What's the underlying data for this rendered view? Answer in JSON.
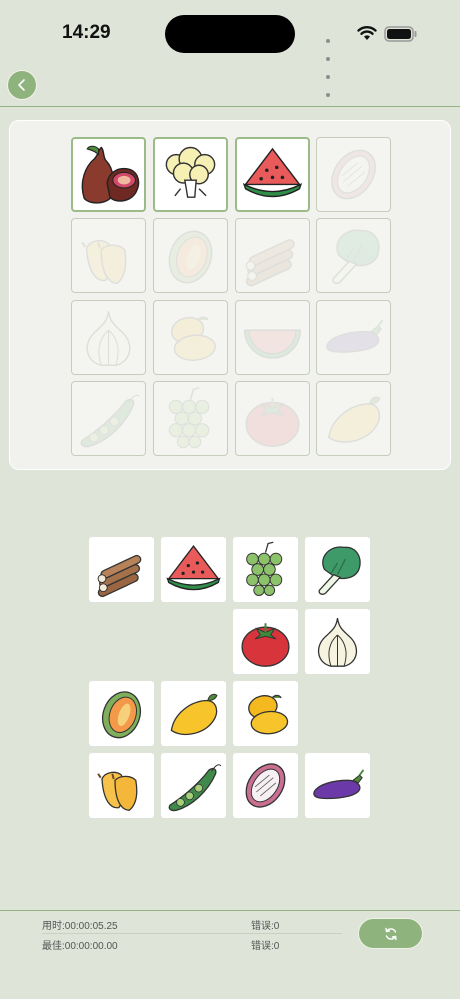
{
  "status_bar": {
    "time": "14:29"
  },
  "icons": {
    "back": "chevron-left-icon",
    "reset": "refresh-icon",
    "wifi": "wifi-icon",
    "battery": "battery-icon"
  },
  "colors": {
    "background": "#dfe4d8",
    "accent": "#8fb37d",
    "board": "#f1f2ed"
  },
  "target_board": {
    "rows": [
      [
        "fig",
        "cauliflower",
        "watermelon",
        "dragon-fruit"
      ],
      [
        "banana",
        "cantaloupe",
        "yam",
        "bok-choy"
      ],
      [
        "garlic",
        "mango",
        "watermelon-slice",
        "eggplant"
      ],
      [
        "pea-pod",
        "grapes",
        "tomato",
        "mango-single"
      ]
    ],
    "filled_cells": [
      "fig",
      "cauliflower",
      "watermelon"
    ]
  },
  "pieces": [
    [
      "yam",
      "watermelon",
      "grapes",
      "bok-choy"
    ],
    [
      "",
      "",
      "tomato",
      "garlic"
    ],
    [
      "cantaloupe",
      "mango-single",
      "mango",
      ""
    ],
    [
      "banana",
      "pea-pod",
      "dragon-fruit",
      "eggplant"
    ]
  ],
  "footer": {
    "time_label": "用时:",
    "time_value": "00:00:05.25",
    "error_label_1": "错误:",
    "error_value_1": "0",
    "best_label": "最佳:",
    "best_value": "00:00:00.00",
    "error_label_2": "错误:",
    "error_value_2": "0"
  }
}
